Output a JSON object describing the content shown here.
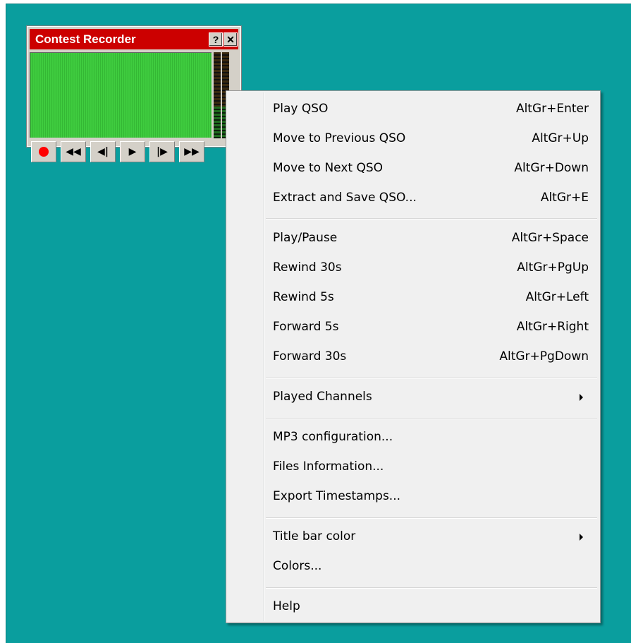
{
  "recorder": {
    "title": "Contest Recorder",
    "help_label": "?",
    "close_label": "✕",
    "controls": [
      "⏺",
      "⏮",
      "◀",
      "▶",
      "▶|",
      "⏭"
    ],
    "record_color": "#ff0000",
    "title_color": "#cc0000",
    "wave_color": "#3fcc3f"
  },
  "menu": {
    "items": [
      {
        "label": "Play QSO",
        "shortcut": "AltGr+Enter"
      },
      {
        "label": "Move to Previous QSO",
        "shortcut": "AltGr+Up"
      },
      {
        "label": "Move to Next QSO",
        "shortcut": "AltGr+Down"
      },
      {
        "label": "Extract and Save QSO...",
        "shortcut": "AltGr+E"
      },
      {
        "label": "Play/Pause",
        "shortcut": "AltGr+Space"
      },
      {
        "label": "Rewind 30s",
        "shortcut": "AltGr+PgUp"
      },
      {
        "label": "Rewind 5s",
        "shortcut": "AltGr+Left"
      },
      {
        "label": "Forward 5s",
        "shortcut": "AltGr+Right"
      },
      {
        "label": "Forward 30s",
        "shortcut": "AltGr+PgDown"
      },
      {
        "label": "Played Channels",
        "submenu": true
      },
      {
        "label": "MP3 configuration..."
      },
      {
        "label": "Files Information..."
      },
      {
        "label": "Export Timestamps..."
      },
      {
        "label": "Title bar color",
        "submenu": true
      },
      {
        "label": "Colors..."
      },
      {
        "label": "Help"
      }
    ]
  },
  "colors": {
    "desktop": "#0a9e9e",
    "menu_bg": "#f0f0f0"
  }
}
